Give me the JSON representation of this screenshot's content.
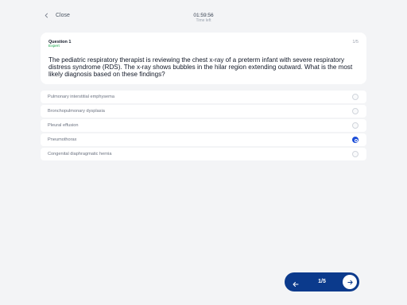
{
  "header": {
    "close_label": "Close",
    "time_value": "01:59:56",
    "time_label": "Time left"
  },
  "question": {
    "title": "Question 1",
    "difficulty": "Expert",
    "counter": "1/5",
    "text": "The pediatric respiratory therapist is reviewing the chest x-ray of a preterm infant with severe respiratory distress syndrome (RDS). The x-ray shows bubbles in the hilar region extending outward. What is the most likely diagnosis based on these findings?"
  },
  "options": [
    {
      "label": "Pulmonary interstitial emphysema",
      "selected": false
    },
    {
      "label": "Bronchopulmonary dysplasia",
      "selected": false
    },
    {
      "label": "Pleural effusion",
      "selected": false
    },
    {
      "label": "Pneumothorax",
      "selected": true
    },
    {
      "label": "Congenital diaphragmatic hernia",
      "selected": false
    }
  ],
  "nav": {
    "progress": "1/5",
    "prev_icon": "arrow-left-icon",
    "next_icon": "arrow-right-icon"
  },
  "colors": {
    "background": "#f3f4f6",
    "accent": "#1d4ed8",
    "nav_bg": "#0b3a8c",
    "difficulty": "#16a34a"
  }
}
